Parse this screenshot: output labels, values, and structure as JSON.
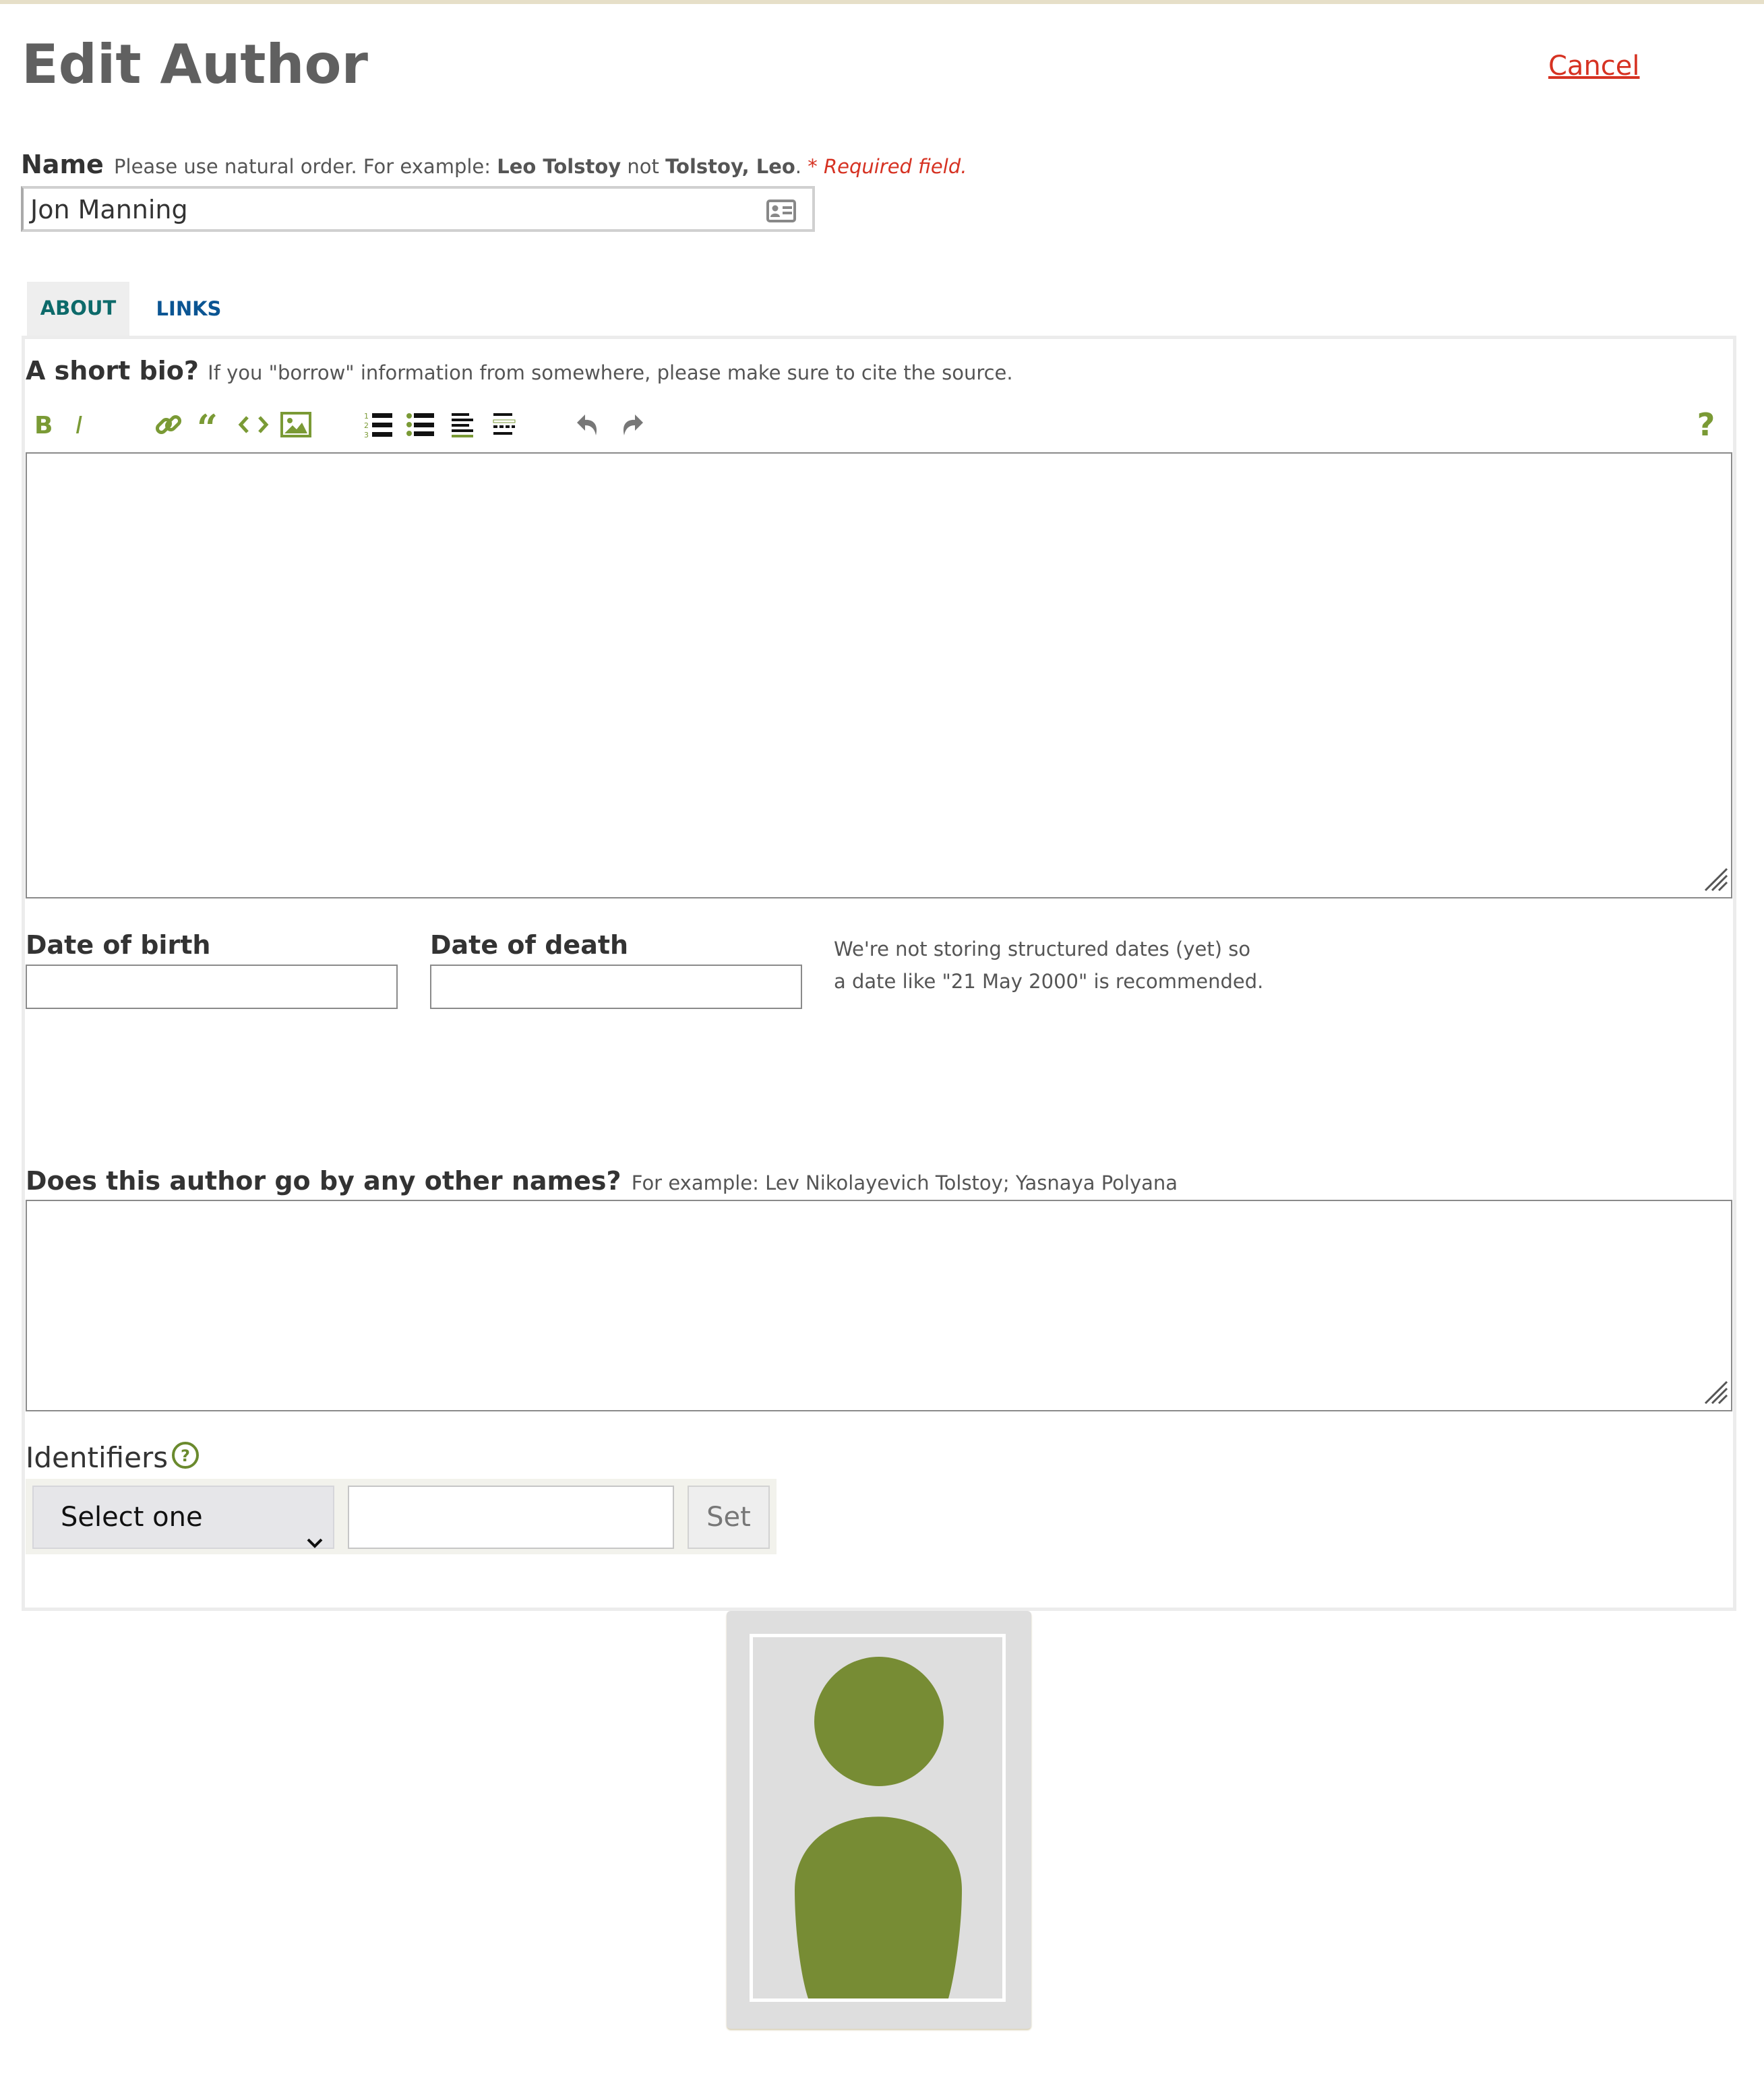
{
  "page": {
    "title": "Edit Author",
    "cancel_label": "Cancel"
  },
  "name_field": {
    "label": "Name",
    "hint_pre": "Please use natural order. For example: ",
    "example_good": "Leo Tolstoy",
    "hint_mid": " not ",
    "example_bad": "Tolstoy, Leo",
    "hint_post": ". ",
    "required": "* Required field.",
    "value": "Jon Manning",
    "icon": "contact-card-icon"
  },
  "tabs": [
    {
      "label": "ABOUT",
      "active": true
    },
    {
      "label": "LINKS",
      "active": false
    }
  ],
  "bio": {
    "label": "A short bio?",
    "hint": "If you \"borrow\" information from somewhere, please make sure to cite the source.",
    "value": ""
  },
  "toolbar": {
    "buttons": [
      "bold-icon",
      "italic-icon",
      "link-icon",
      "blockquote-icon",
      "code-icon",
      "image-icon",
      "numbered-list-icon",
      "bulleted-list-icon",
      "heading-icon",
      "horizontal-rule-icon",
      "undo-icon",
      "redo-icon"
    ],
    "help_label": "?"
  },
  "dates": {
    "birth_label": "Date of birth",
    "birth_value": "",
    "death_label": "Date of death",
    "death_value": "",
    "note": "We're not storing structured dates (yet) so a date like \"21 May 2000\" is recommended."
  },
  "alternate_names": {
    "label": "Does this author go by any other names?",
    "hint": "For example: Lev Nikolayevich Tolstoy; Yasnaya Polyana",
    "value": ""
  },
  "identifiers": {
    "label": "Identifiers",
    "help_icon": "help-circle-icon",
    "select_value": "Select one",
    "input_value": "",
    "set_label": "Set"
  },
  "photo": {
    "icon": "person-placeholder-icon"
  },
  "colors": {
    "accent_green": "#7a9a35",
    "cancel_red": "#d63222",
    "tab_teal": "#0d6a6a",
    "tab_blue": "#0b5593"
  }
}
